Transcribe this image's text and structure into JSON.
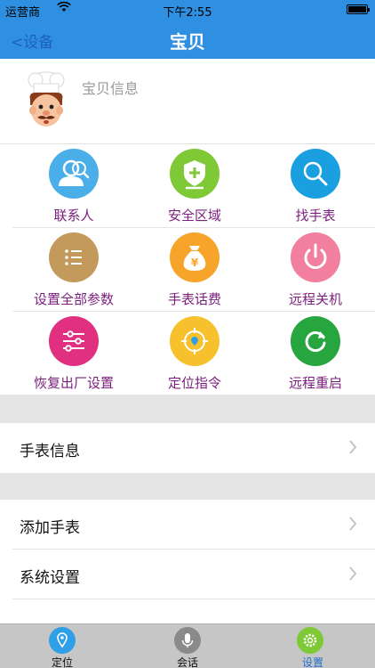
{
  "status_bar": {
    "carrier": "运营商",
    "time": "下午2:55"
  },
  "nav": {
    "back_label": "<设备",
    "title": "宝贝"
  },
  "profile": {
    "label": "宝贝信息",
    "avatar_icon": "chef-avatar-icon"
  },
  "grid": [
    [
      {
        "label": "联系人",
        "icon": "contacts-icon",
        "color": "#4aaee8"
      },
      {
        "label": "安全区域",
        "icon": "shield-plus-icon",
        "color": "#7ec935"
      },
      {
        "label": "找手表",
        "icon": "magnifier-icon",
        "color": "#1a9fe0"
      }
    ],
    [
      {
        "label": "设置全部参数",
        "icon": "list-settings-icon",
        "color": "#c49a5c"
      },
      {
        "label": "手表话费",
        "icon": "money-bag-icon",
        "color": "#f6a52a"
      },
      {
        "label": "远程关机",
        "icon": "power-icon",
        "color": "#f27f9e"
      }
    ],
    [
      {
        "label": "恢复出厂设置",
        "icon": "sliders-icon",
        "color": "#e0307f"
      },
      {
        "label": "定位指令",
        "icon": "locate-target-icon",
        "color": "#f6c12c"
      },
      {
        "label": "远程重启",
        "icon": "restart-icon",
        "color": "#27a63f"
      }
    ]
  ],
  "list": {
    "watch_info": "手表信息",
    "add_watch": "添加手表",
    "system_settings": "系统设置"
  },
  "tabs": [
    {
      "label": "定位",
      "icon": "location-pin-icon",
      "color": "#2f9fe6"
    },
    {
      "label": "会话",
      "icon": "microphone-icon",
      "color": "#8a8a8a"
    },
    {
      "label": "设置",
      "icon": "gear-icon",
      "color": "#7ec935"
    }
  ]
}
